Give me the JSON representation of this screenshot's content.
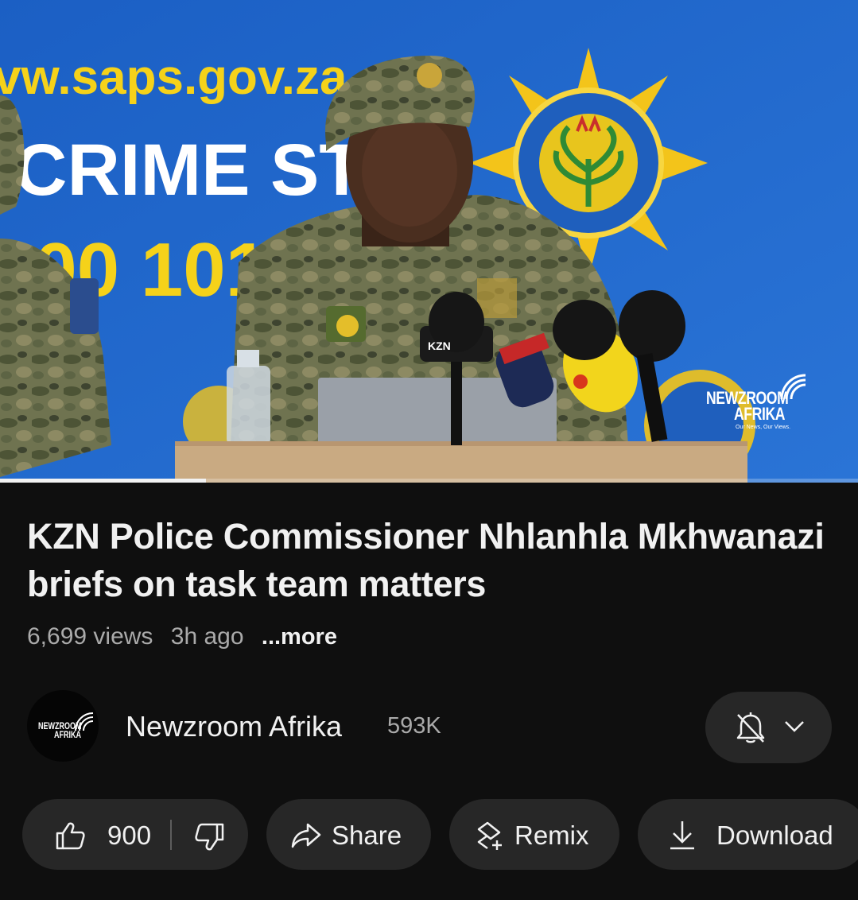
{
  "video": {
    "watermark_line1": "NEWZROOM",
    "watermark_line2": "AFRIKA",
    "watermark_tagline": "Our News, Our Views.",
    "progress_fraction": 0.24
  },
  "title": "KZN Police Commissioner Nhlanhla Mkhwanazi briefs on task team matters",
  "meta": {
    "views": "6,699 views",
    "age": "3h ago",
    "more": "...more"
  },
  "channel": {
    "name": "Newzroom Afrika",
    "subscribers": "593K",
    "avatar_line1": "NEWZROOM",
    "avatar_line2": "AFRIKA"
  },
  "actions": {
    "like_count": "900",
    "share_label": "Share",
    "remix_label": "Remix",
    "download_label": "Download"
  },
  "icons": {
    "like": "thumbs-up-icon",
    "dislike": "thumbs-down-icon",
    "share": "share-arrow-icon",
    "remix": "remix-icon",
    "download": "download-icon",
    "bell": "bell-off-icon",
    "chevron": "chevron-down-icon"
  },
  "colors": {
    "background": "#0f0f0f",
    "pill": "#272727",
    "text_primary": "#f1f1f1",
    "text_secondary": "#aaaaaa",
    "backdrop_blue": "#1d63c9"
  }
}
